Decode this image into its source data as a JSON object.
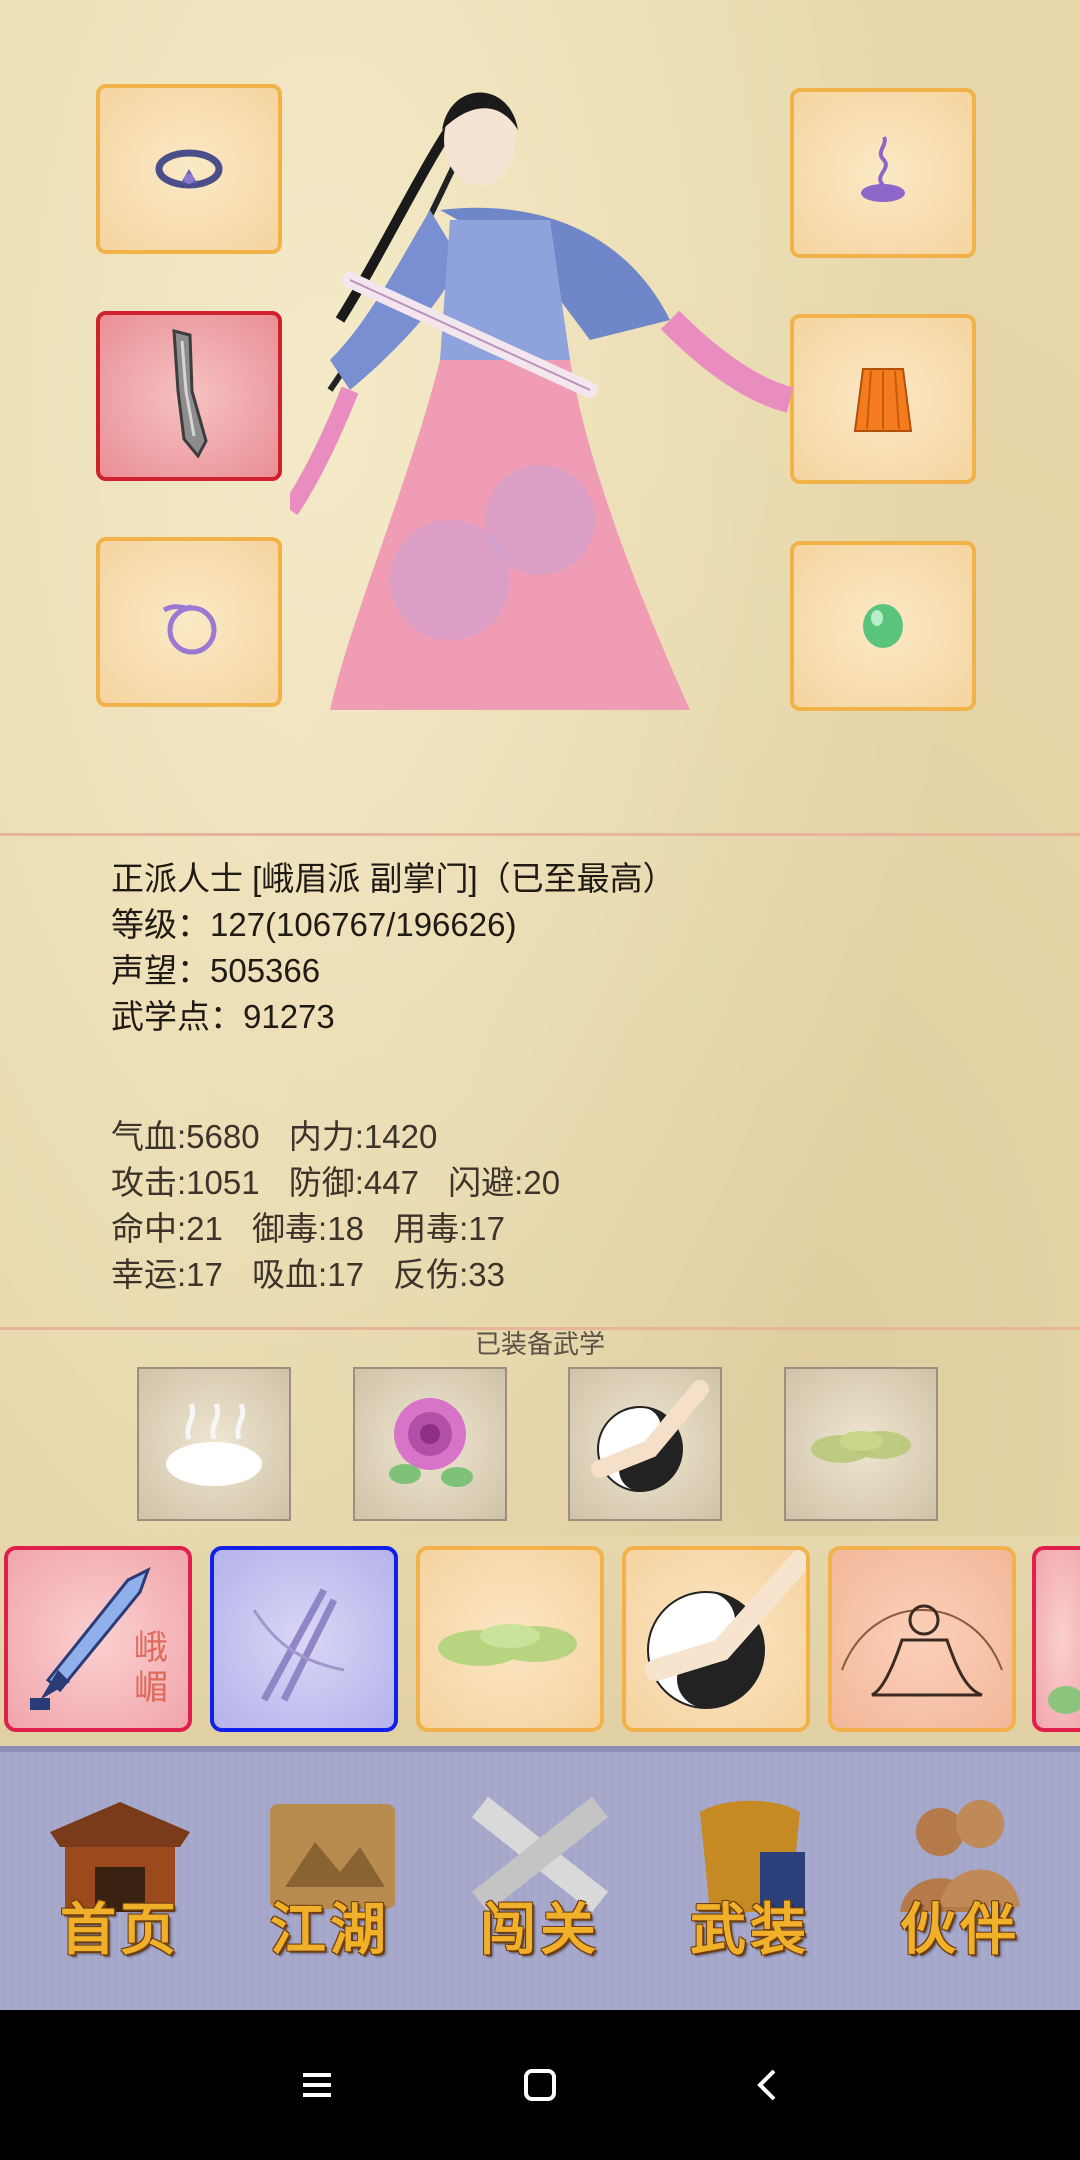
{
  "character": {
    "faction_title": "正派人士 [峨眉派 副掌门]（已至最高）",
    "level_line": "等级：127(106767/196626)",
    "fame_line": "声望：505366",
    "martial_points_line": "武学点：91273"
  },
  "attributes": {
    "row1": [
      "气血:5680",
      "内力:1420"
    ],
    "row2": [
      "攻击:1051",
      "防御:447",
      "闪避:20"
    ],
    "row3": [
      "命中:21",
      "御毒:18",
      "用毒:17"
    ],
    "row4": [
      "幸运:17",
      "吸血:17",
      "反伤:33"
    ]
  },
  "equipped_martial_arts": {
    "title": "已装备武学",
    "icons": [
      "steam-cloud-icon",
      "rose-icon",
      "taiji-palm-icon",
      "green-mist-icon"
    ]
  },
  "equipment_slots": {
    "left": [
      "ring-icon",
      "blade-icon",
      "bracelet-icon"
    ],
    "right": [
      "incense-icon",
      "skirt-icon",
      "jade-icon"
    ]
  },
  "skill_bar": {
    "tiles": [
      {
        "icon": "sword-icon",
        "label": "峨嵋"
      },
      {
        "icon": "crossed-swords-icon"
      },
      {
        "icon": "green-mist-icon"
      },
      {
        "icon": "taiji-palm-icon"
      },
      {
        "icon": "buddha-meditation-icon"
      },
      {
        "icon": "flower-icon"
      }
    ]
  },
  "nav": {
    "items": [
      {
        "label": "首页",
        "icon": "house-icon"
      },
      {
        "label": "江湖",
        "icon": "scroll-map-icon"
      },
      {
        "label": "闯关",
        "icon": "crossed-blades-icon"
      },
      {
        "label": "武装",
        "icon": "armor-icon"
      },
      {
        "label": "伙伴",
        "icon": "companions-icon"
      }
    ]
  },
  "colors": {
    "slot_border": "#f2b24a",
    "selected_red": "#d1202e",
    "selected_blue": "#1020e8",
    "nav_label": "#f1b02a"
  }
}
